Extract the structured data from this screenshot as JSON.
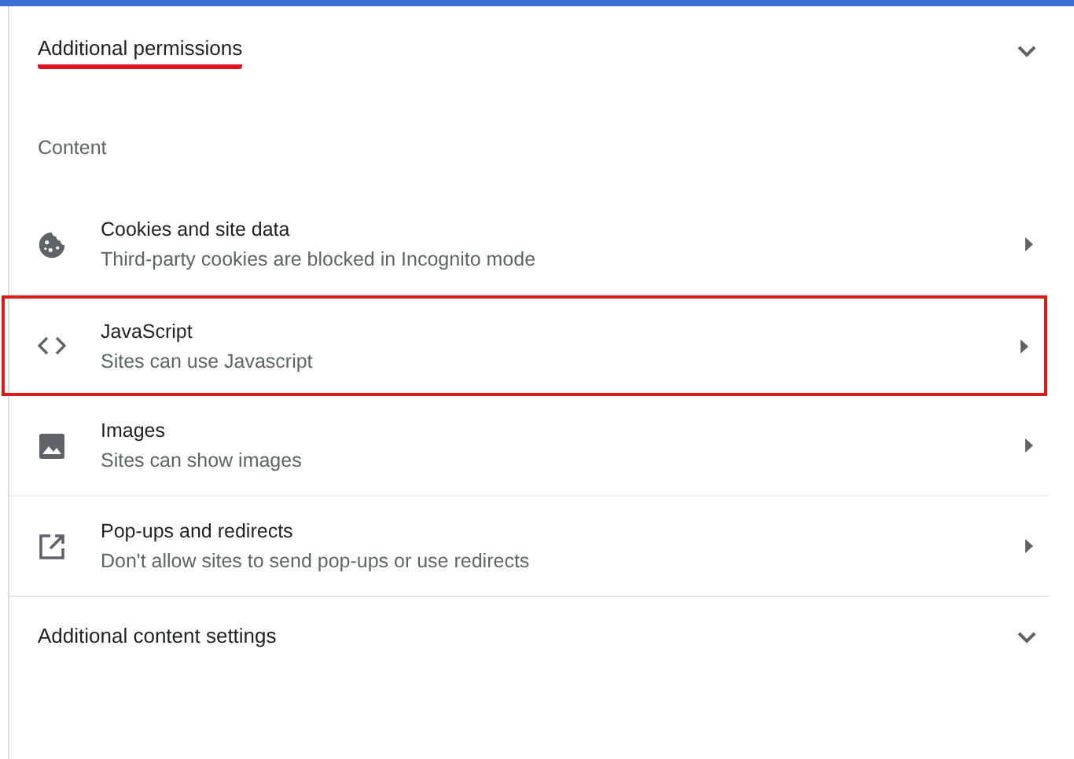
{
  "permissions_header": {
    "title": "Additional permissions",
    "underlined": true,
    "expanded": false
  },
  "content_section": {
    "label": "Content",
    "items": [
      {
        "kind": "cookie",
        "title": "Cookies and site data",
        "subtitle": "Third-party cookies are blocked in Incognito mode",
        "highlighted": false
      },
      {
        "kind": "code",
        "title": "JavaScript",
        "subtitle": "Sites can use Javascript",
        "highlighted": true
      },
      {
        "kind": "image",
        "title": "Images",
        "subtitle": "Sites can show images",
        "highlighted": false
      },
      {
        "kind": "external",
        "title": "Pop-ups and redirects",
        "subtitle": "Don't allow sites to send pop-ups or use redirects",
        "highlighted": false
      }
    ]
  },
  "content_settings_header": {
    "title": "Additional content settings",
    "expanded": false
  }
}
